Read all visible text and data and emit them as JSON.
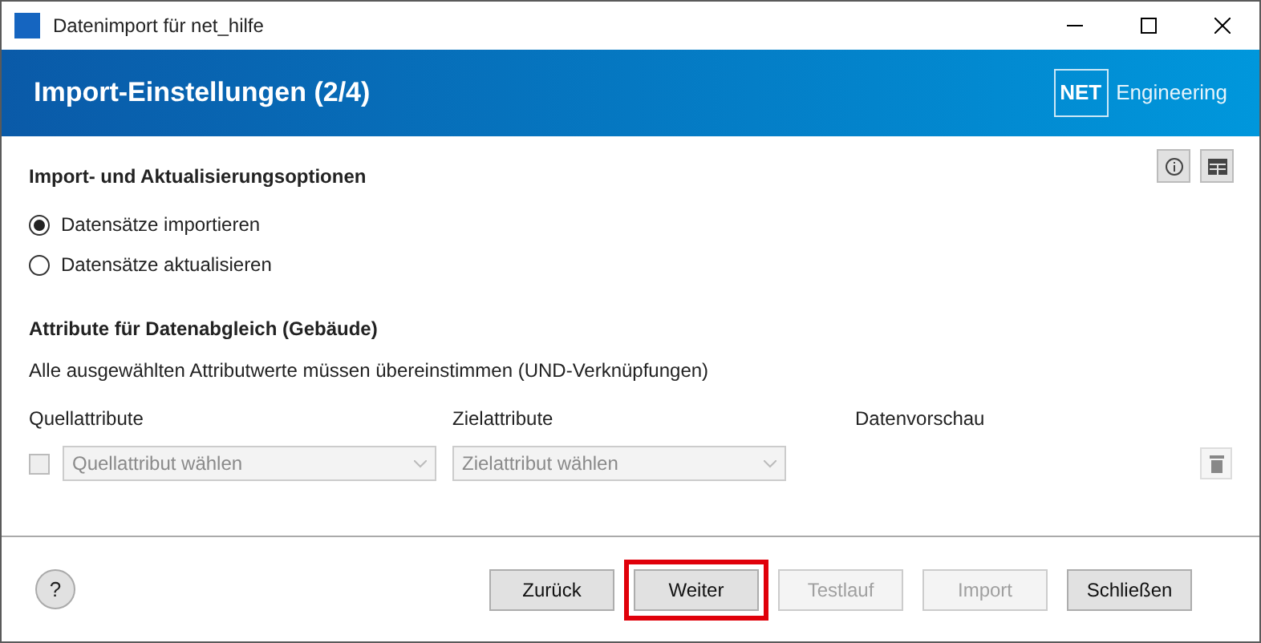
{
  "window": {
    "title": "Datenimport für net_hilfe"
  },
  "header": {
    "title": "Import-Einstellungen (2/4)",
    "logo": "NET",
    "brand": "Engineering"
  },
  "options_section": {
    "title": "Import- und Aktualisierungsoptionen",
    "options": [
      {
        "label": "Datensätze importieren",
        "selected": true
      },
      {
        "label": "Datensätze aktualisieren",
        "selected": false
      }
    ]
  },
  "matching": {
    "title": "Attribute für Datenabgleich (Gebäude)",
    "description": "Alle ausgewählten Attributwerte müssen übereinstimmen (UND-Verknüpfungen)",
    "columns": [
      "Quellattribute",
      "Zielattribute",
      "Datenvorschau"
    ],
    "rows": [
      {
        "checked": false,
        "source": {
          "placeholder": "Quellattribut wählen",
          "disabled": true
        },
        "target": {
          "placeholder": "Zielattribut wählen",
          "disabled": true
        }
      }
    ]
  },
  "help_button": "?",
  "buttons": [
    {
      "label": "Zurück",
      "disabled": false,
      "highlighted": false
    },
    {
      "label": "Weiter",
      "disabled": false,
      "highlighted": true
    },
    {
      "label": "Testlauf",
      "disabled": true,
      "highlighted": false
    },
    {
      "label": "Import",
      "disabled": true,
      "highlighted": false
    },
    {
      "label": "Schließen",
      "disabled": false,
      "highlighted": false
    }
  ]
}
